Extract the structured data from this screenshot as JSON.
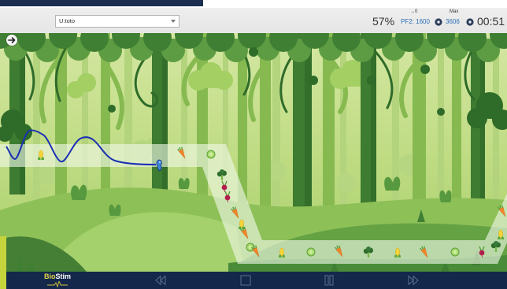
{
  "header": {
    "user_select": {
      "value": "U:toto"
    },
    "percentage": "57%",
    "pf2": {
      "caption": "→0",
      "label": "PF2: 1600",
      "icon": "adjust-icon"
    },
    "max": {
      "caption": "Max",
      "value": "3606",
      "icon": "adjust-icon"
    },
    "timer": "00:51"
  },
  "game": {
    "start_icon": "arrow-right-circle-icon",
    "player_icon": "player-icon",
    "items": [
      "corn",
      "carrot",
      "cabbage",
      "broccoli",
      "beet",
      "beet",
      "carrot",
      "corn",
      "carrot",
      "cabbage",
      "carrot",
      "corn",
      "cabbage",
      "carrot",
      "broccoli",
      "corn",
      "carrot",
      "cabbage",
      "beet",
      "broccoli",
      "corn",
      "carrot"
    ]
  },
  "footer": {
    "logo": {
      "part1": "Bio",
      "part2": "Stim"
    },
    "controls": [
      {
        "name": "rewind",
        "icon": "rewind-icon"
      },
      {
        "name": "stop",
        "icon": "stop-icon"
      },
      {
        "name": "pause",
        "icon": "pause-icon"
      },
      {
        "name": "fast-forward",
        "icon": "fast-forward-icon"
      }
    ]
  },
  "colors": {
    "header_bg": "#e6e6e6",
    "value_blue": "#2a6db5",
    "footer_bg": "#14284b",
    "trace_blue": "#1b2fb5",
    "logo_yellow": "#e3d548",
    "accent_lime": "#c5d43c"
  }
}
